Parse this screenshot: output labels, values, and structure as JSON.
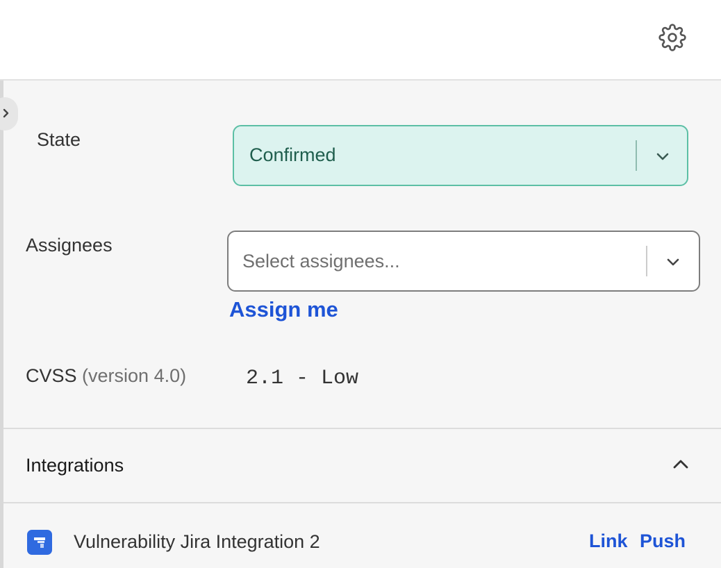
{
  "icons": {
    "settings": "gear-icon",
    "collapse": "chevron-right-icon",
    "select_dropdown": "chevron-down-icon",
    "section_toggle": "chevron-up-icon",
    "integration": "jira-icon"
  },
  "colors": {
    "state_background": "#dcf3ef",
    "state_border": "#5cbfa5",
    "link": "#1e54d6"
  },
  "state": {
    "label": "State",
    "value": "Confirmed"
  },
  "assignees": {
    "label": "Assignees",
    "placeholder": "Select assignees...",
    "assign_me_label": "Assign me"
  },
  "cvss": {
    "label": "CVSS",
    "version": "(version 4.0)",
    "value": "2.1 - Low"
  },
  "integrations": {
    "title": "Integrations",
    "items": [
      {
        "name": "Vulnerability Jira Integration 2",
        "link_label": "Link",
        "push_label": "Push"
      }
    ]
  }
}
